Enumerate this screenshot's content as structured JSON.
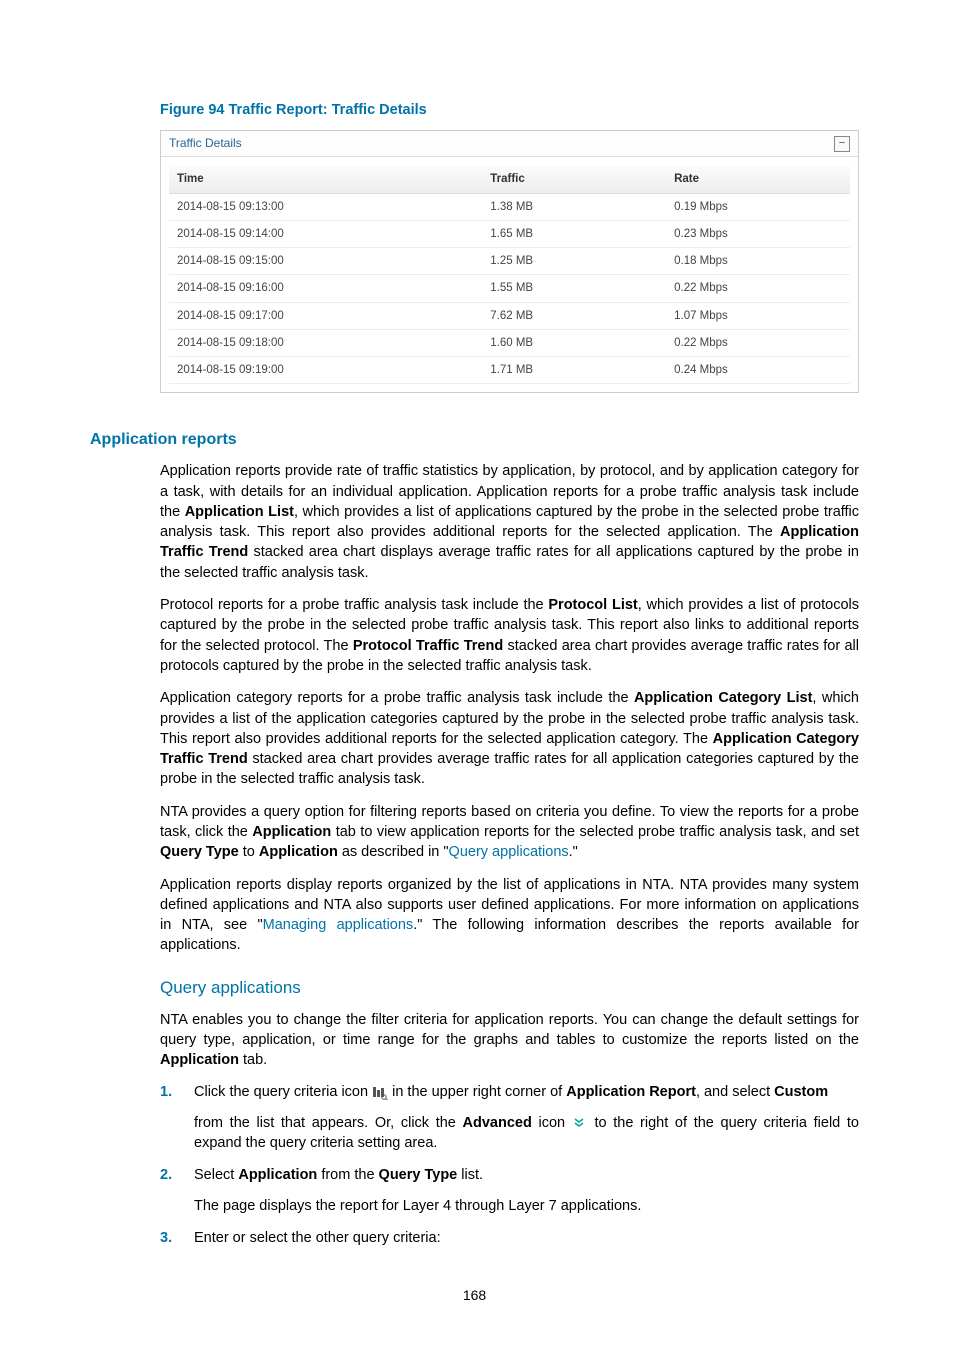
{
  "figure": {
    "caption": "Figure 94 Traffic Report: Traffic Details",
    "panel_title": "Traffic Details",
    "columns": {
      "time": "Time",
      "traffic": "Traffic",
      "rate": "Rate"
    },
    "rows": [
      {
        "time": "2014-08-15 09:13:00",
        "traffic": "1.38 MB",
        "rate": "0.19 Mbps"
      },
      {
        "time": "2014-08-15 09:14:00",
        "traffic": "1.65 MB",
        "rate": "0.23 Mbps"
      },
      {
        "time": "2014-08-15 09:15:00",
        "traffic": "1.25 MB",
        "rate": "0.18 Mbps"
      },
      {
        "time": "2014-08-15 09:16:00",
        "traffic": "1.55 MB",
        "rate": "0.22 Mbps"
      },
      {
        "time": "2014-08-15 09:17:00",
        "traffic": "7.62 MB",
        "rate": "1.07 Mbps"
      },
      {
        "time": "2014-08-15 09:18:00",
        "traffic": "1.60 MB",
        "rate": "0.22 Mbps"
      },
      {
        "time": "2014-08-15 09:19:00",
        "traffic": "1.71 MB",
        "rate": "0.24 Mbps"
      }
    ]
  },
  "headings": {
    "section": "Application reports",
    "subsection": "Query applications"
  },
  "paragraphs": {
    "p1a": "Application reports provide rate of traffic statistics by application, by protocol, and by application category for a task, with details for an individual application. Application reports for a probe traffic analysis task include the ",
    "p1b": "Application List",
    "p1c": ", which provides a list of applications captured by the probe in the selected probe traffic analysis task. This report also provides additional reports for the selected application. The ",
    "p1d": "Application Traffic Trend",
    "p1e": " stacked area chart displays average traffic rates for all applications captured by the probe in the selected traffic analysis task.",
    "p2a": "Protocol reports for a probe traffic analysis task include the ",
    "p2b": "Protocol List",
    "p2c": ", which provides a list of protocols captured by the probe in the selected probe traffic analysis task. This report also links to additional reports for the selected protocol. The ",
    "p2d": "Protocol Traffic Trend",
    "p2e": " stacked area chart provides average traffic rates for all protocols captured by the probe in the selected traffic analysis task.",
    "p3a": "Application category reports for a probe traffic analysis task include the ",
    "p3b": "Application Category List",
    "p3c": ", which provides a list of the application categories captured by the probe in the selected probe traffic analysis task. This report also provides additional reports for the selected application category. The ",
    "p3d": "Application Category Traffic Trend",
    "p3e": " stacked area chart provides average traffic rates for all application categories captured by the probe in the selected traffic analysis task.",
    "p4a": "NTA provides a query option for filtering reports based on criteria you define. To view the reports for a probe task, click the ",
    "p4b": "Application",
    "p4c": " tab to view application reports for the selected probe traffic analysis task, and set ",
    "p4d": "Query Type",
    "p4e": " to ",
    "p4f": "Application",
    "p4g": " as described in \"",
    "p4h": "Query applications",
    "p4i": ".\"",
    "p5a": "Application reports display reports organized by the list of applications in NTA. NTA provides many system defined applications and NTA also supports user defined applications. For more information on applications in NTA, see \"",
    "p5b": "Managing applications",
    "p5c": ".\" The following information describes the reports available for applications.",
    "p6a": "NTA enables you to change the filter criteria for application reports. You can change the default settings for query type, application, or time range for the graphs and tables to customize the reports listed on the ",
    "p6b": "Application",
    "p6c": " tab."
  },
  "steps": {
    "s1a": "Click the query criteria icon ",
    "s1b": " in the upper right corner of ",
    "s1c": "Application Report",
    "s1d": ", and select ",
    "s1e": "Custom",
    "s1f": " from the list that appears. Or, click the ",
    "s1g": "Advanced",
    "s1h": " icon ",
    "s1i": " to the right of the query criteria field to expand the query criteria setting area.",
    "s2a": "Select ",
    "s2b": "Application",
    "s2c": " from the ",
    "s2d": "Query Type",
    "s2e": " list.",
    "s2sub": "The page displays the report for Layer 4 through Layer 7 applications.",
    "s3": "Enter or select the other query criteria:"
  },
  "page_number": "168"
}
